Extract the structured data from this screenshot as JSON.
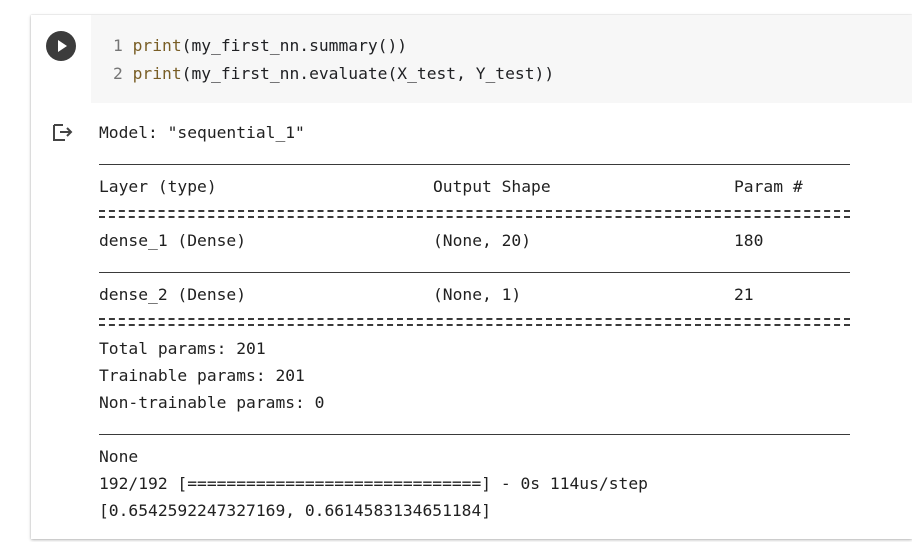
{
  "code_cell": {
    "lines": [
      {
        "number": "1",
        "func": "print",
        "rest": "(my_first_nn.summary())"
      },
      {
        "number": "2",
        "func": "print",
        "rest": "(my_first_nn.evaluate(X_test, Y_test))"
      }
    ]
  },
  "output": {
    "model_line": "Model: \"sequential_1\"",
    "headers": {
      "layer": "Layer (type)",
      "output_shape": "Output Shape",
      "params": "Param #"
    },
    "rows": [
      {
        "layer": "dense_1 (Dense)",
        "output_shape": "(None, 20)",
        "params": "180"
      },
      {
        "layer": "dense_2 (Dense)",
        "output_shape": "(None, 1)",
        "params": "21"
      }
    ],
    "total_params": "Total params: 201",
    "trainable_params": "Trainable params: 201",
    "non_trainable_params": "Non-trainable params: 0",
    "none_line": "None",
    "progress_line": "192/192 [==============================] - 0s 114us/step",
    "result_line": "[0.6542592247327169, 0.6614583134651184]"
  }
}
